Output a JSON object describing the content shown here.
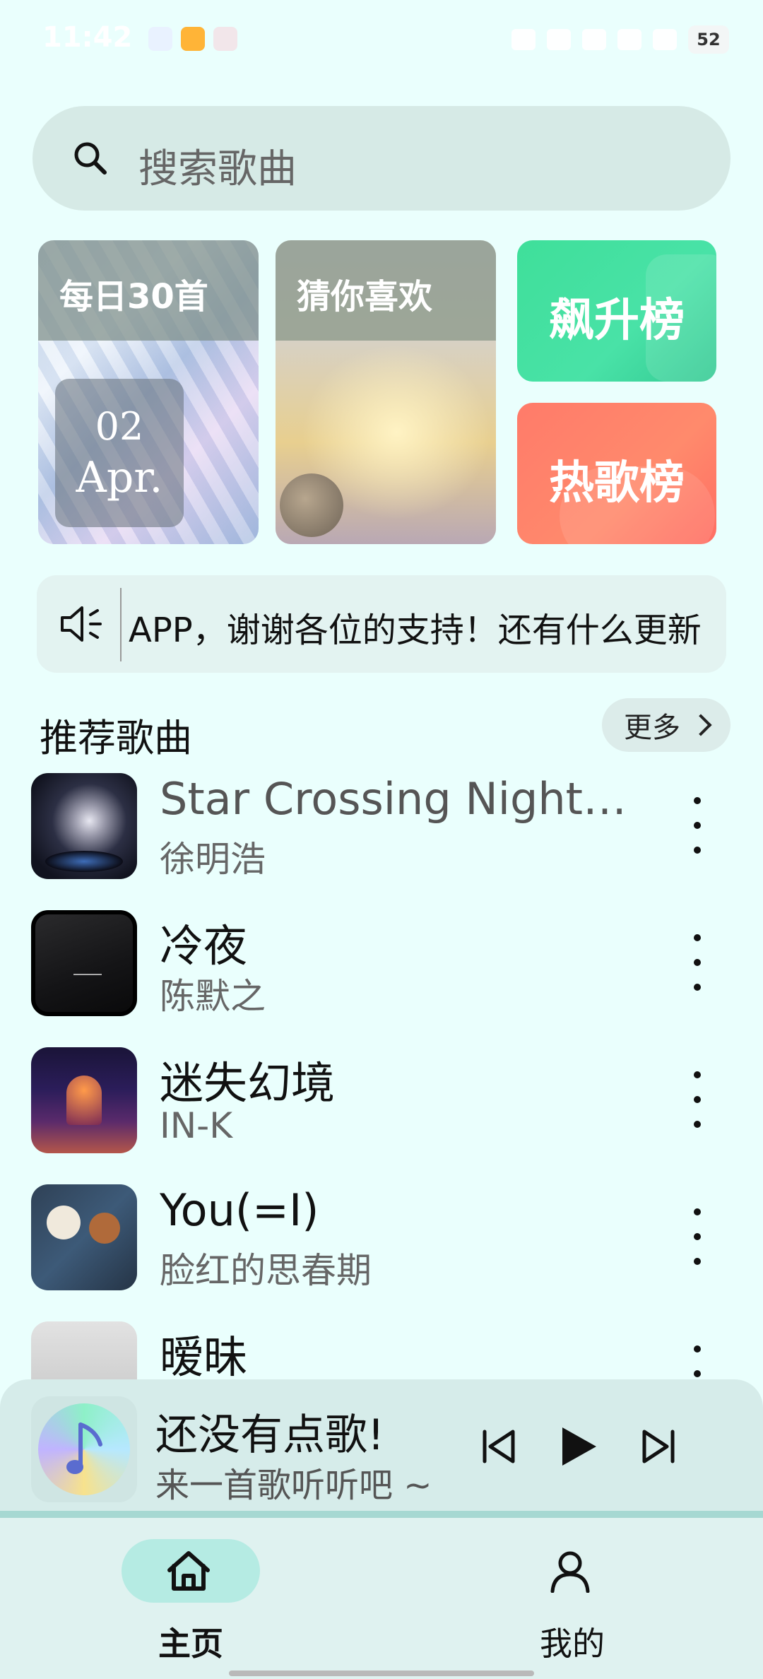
{
  "status_bar": {
    "time": "11:42",
    "battery": "52",
    "app_icons": [
      "app-icon-1",
      "app-icon-2",
      "app-icon-3"
    ],
    "system_icons": [
      "bluetooth-icon",
      "vibrate-icon",
      "hd-icon",
      "signal-icon",
      "wifi-icon"
    ]
  },
  "search": {
    "placeholder": "搜索歌曲"
  },
  "cards": {
    "daily": {
      "title": "每日30首",
      "day": "02",
      "month": "Apr."
    },
    "guess": {
      "title": "猜你喜欢"
    },
    "rising": {
      "title": "飙升榜",
      "color": "#45e0a2"
    },
    "hot": {
      "title": "热歌榜",
      "color": "#ff7b67"
    }
  },
  "notice": {
    "text": "APP，谢谢各位的支持！还有什么更新"
  },
  "recommend": {
    "title": "推荐歌曲",
    "more_label": "更多",
    "songs": [
      {
        "title": "Star Crossing Night…",
        "artist": "徐明浩"
      },
      {
        "title": "冷夜",
        "artist": "陈默之"
      },
      {
        "title": "迷失幻境",
        "artist": "IN-K"
      },
      {
        "title": "You(=I)",
        "artist": "脸红的思春期"
      },
      {
        "title": "暧昧",
        "artist": ""
      }
    ]
  },
  "player": {
    "title": "还没有点歌!",
    "subtitle": "来一首歌听听吧 ~"
  },
  "tabs": [
    {
      "label": "主页",
      "icon": "home-icon",
      "active": true
    },
    {
      "label": "我的",
      "icon": "user-icon",
      "active": false
    }
  ],
  "colors": {
    "background": "#eafffd",
    "accent": "#b5ebe3"
  }
}
